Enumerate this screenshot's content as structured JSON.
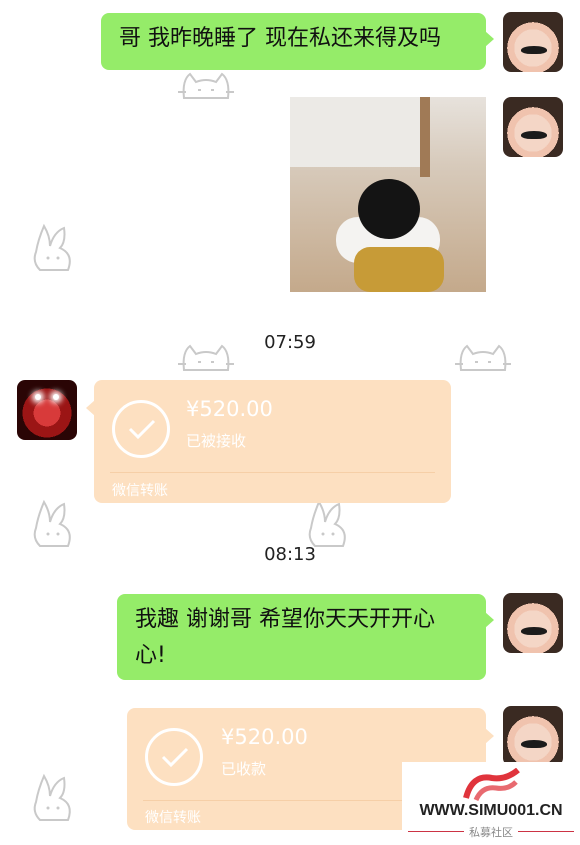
{
  "messages": {
    "msg1": "哥 我昨晚睡了 现在私还来得及吗",
    "time1": "07:59",
    "transfer1": {
      "amount": "¥520.00",
      "status": "已被接收",
      "footer": "微信转账"
    },
    "time2": "08:13",
    "msg2_line1": "我趣 谢谢哥  希望你天天开开心",
    "msg2_line2": "心!",
    "transfer2": {
      "amount": "¥520.00",
      "status": "已收款",
      "footer": "微信转账"
    }
  },
  "watermark": {
    "site": "WWW.SIMU001.CN",
    "sub": "私募社区"
  }
}
